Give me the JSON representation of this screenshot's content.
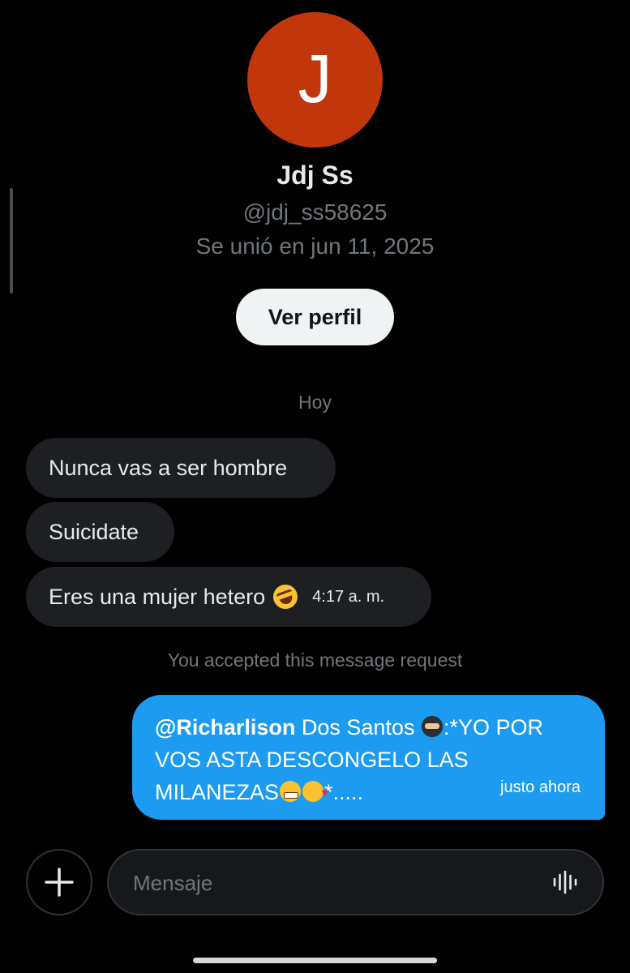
{
  "profile": {
    "avatar_initial": "J",
    "avatar_color": "#c2360c",
    "name": "Jdj Ss",
    "handle": "@jdj_ss58625",
    "joined": "Se unió en jun 11, 2025",
    "view_profile_label": "Ver perfil"
  },
  "conversation": {
    "date_separator": "Hoy",
    "incoming": [
      {
        "text": "Nunca vas a ser hombre"
      },
      {
        "text": "Suicidate"
      },
      {
        "text": "Eres una mujer hetero",
        "emoji": "rolling-on-floor-laughing-emoji",
        "time": "4:17 a. m."
      }
    ],
    "system_note": "You accepted this message request",
    "outgoing": {
      "mention": "@Richarlison",
      "line1_rest": " Dos Santos",
      "line1_after_emoji": ":*YO POR",
      "line2": "VOS ASTA DESCONGELO LAS",
      "line3_start": "MILANEZAS",
      "line3_end": "*.....",
      "emojis": [
        "ninja-emoji",
        "grinning-emoji",
        "smiling-face-with-hearts-emoji"
      ],
      "time": "justo ahora",
      "bubble_color": "#1d9bf0"
    }
  },
  "composer": {
    "placeholder": "Mensaje",
    "plus_icon": "plus-icon",
    "voice_icon": "voice-waveform-icon"
  },
  "colors": {
    "background": "#000000",
    "incoming_bubble": "#1d1f23",
    "muted_text": "#71767b",
    "primary_text": "#e7e9ea",
    "accent": "#1d9bf0"
  }
}
